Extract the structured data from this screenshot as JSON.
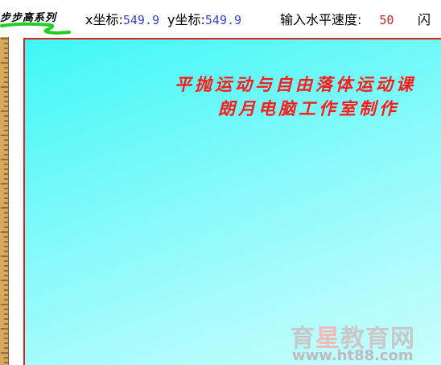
{
  "brand": {
    "label": "步步高系列"
  },
  "coords": {
    "x_label": "x坐标:",
    "x_value": "549.9",
    "y_label": "y坐标:",
    "y_value": "549.9"
  },
  "speed": {
    "label": "输入水平速度:",
    "value": "50"
  },
  "flash_button": {
    "label": "闪"
  },
  "stage": {
    "title_line1": "平抛运动与自由落体运动课",
    "title_line2": "朗月电脑工作室制作"
  },
  "watermark": {
    "name_part1": "育",
    "name_star": "星",
    "name_part2": "教育网",
    "url": "www.ht88.com"
  },
  "colors": {
    "stage_border": "#e02020",
    "title_text": "#ff1a1a",
    "coord_value": "#3344dd",
    "speed_value": "#cc2222",
    "underline": "#22cc22",
    "ruler": "#d8a95c"
  }
}
